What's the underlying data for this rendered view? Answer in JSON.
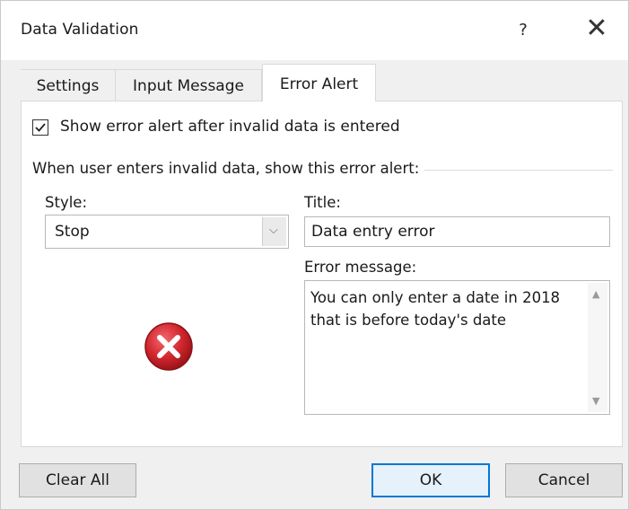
{
  "dialog": {
    "title": "Data Validation",
    "help": "?",
    "close": "✕"
  },
  "tabs": [
    {
      "label": "Settings",
      "active": false
    },
    {
      "label": "Input Message",
      "active": false
    },
    {
      "label": "Error Alert",
      "active": true
    }
  ],
  "error_alert": {
    "show_alert_checked": true,
    "show_alert_label": "Show error alert after invalid data is entered",
    "group_label": "When user enters invalid data, show this error alert:",
    "style_label": "Style:",
    "style_value": "Stop",
    "title_label": "Title:",
    "title_value": "Data entry error",
    "message_label": "Error message:",
    "message_value": "You can only enter a date in 2018 that is before today's date",
    "icon": "error-stop-icon"
  },
  "buttons": {
    "clear_all": "Clear All",
    "ok": "OK",
    "cancel": "Cancel"
  },
  "colors": {
    "accent": "#0078d7",
    "error_red": "#c0262c"
  }
}
